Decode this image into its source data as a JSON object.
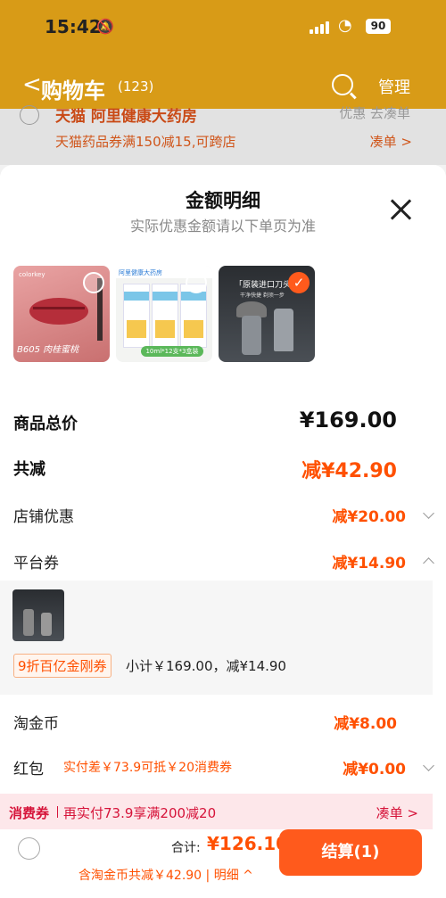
{
  "status": {
    "time": "15:42",
    "battery": "90"
  },
  "nav": {
    "back": "<",
    "title": "购物车",
    "count": "(123)",
    "manage": "管理"
  },
  "behind": {
    "shop": "天猫 阿里健康大药房",
    "right": "优惠 去凑单",
    "promo": "天猫药品券满150减15,可跨店",
    "cou": "凑单 >"
  },
  "sheet": {
    "title": "金额明细",
    "subtitle": "实际优惠金额请以下单页为准",
    "thumbs": [
      {
        "label": "B605 肉桂蜜桃",
        "brand": "colorkey",
        "selected": false
      },
      {
        "label": "阿里健康大药房",
        "foot": "10ml*12支*3盒装",
        "selected": false
      },
      {
        "label": "「原装进口刀头」",
        "sub": "干净快捷 剃须一步",
        "selected": true
      }
    ],
    "total_label": "商品总价",
    "total_value": "¥169.00",
    "discount_label": "共减",
    "discount_value": "减¥42.90",
    "shop_label": "店铺优惠",
    "shop_value": "减¥20.00",
    "platform_label": "平台券",
    "platform_value": "减¥14.90",
    "coupon_tag": "9折百亿金刚券",
    "coupon_text": "小计￥169.00，减¥14.90",
    "coin_label": "淘金币",
    "coin_value": "减¥8.00",
    "red_label": "红包",
    "red_note": "实付差￥73.9可抵￥20消费券",
    "red_value": "减¥0.00"
  },
  "banner": {
    "a": "消费券",
    "b": "再实付73.9享满200减20",
    "c": "凑单 >"
  },
  "footer": {
    "heji": "合计:",
    "total": "¥126.10",
    "detail": "含淘金币共减￥42.90 | 明细 ^",
    "checkout": "结算(1)"
  },
  "colors": {
    "accent": "#ff5000",
    "header": "#d89b17"
  }
}
